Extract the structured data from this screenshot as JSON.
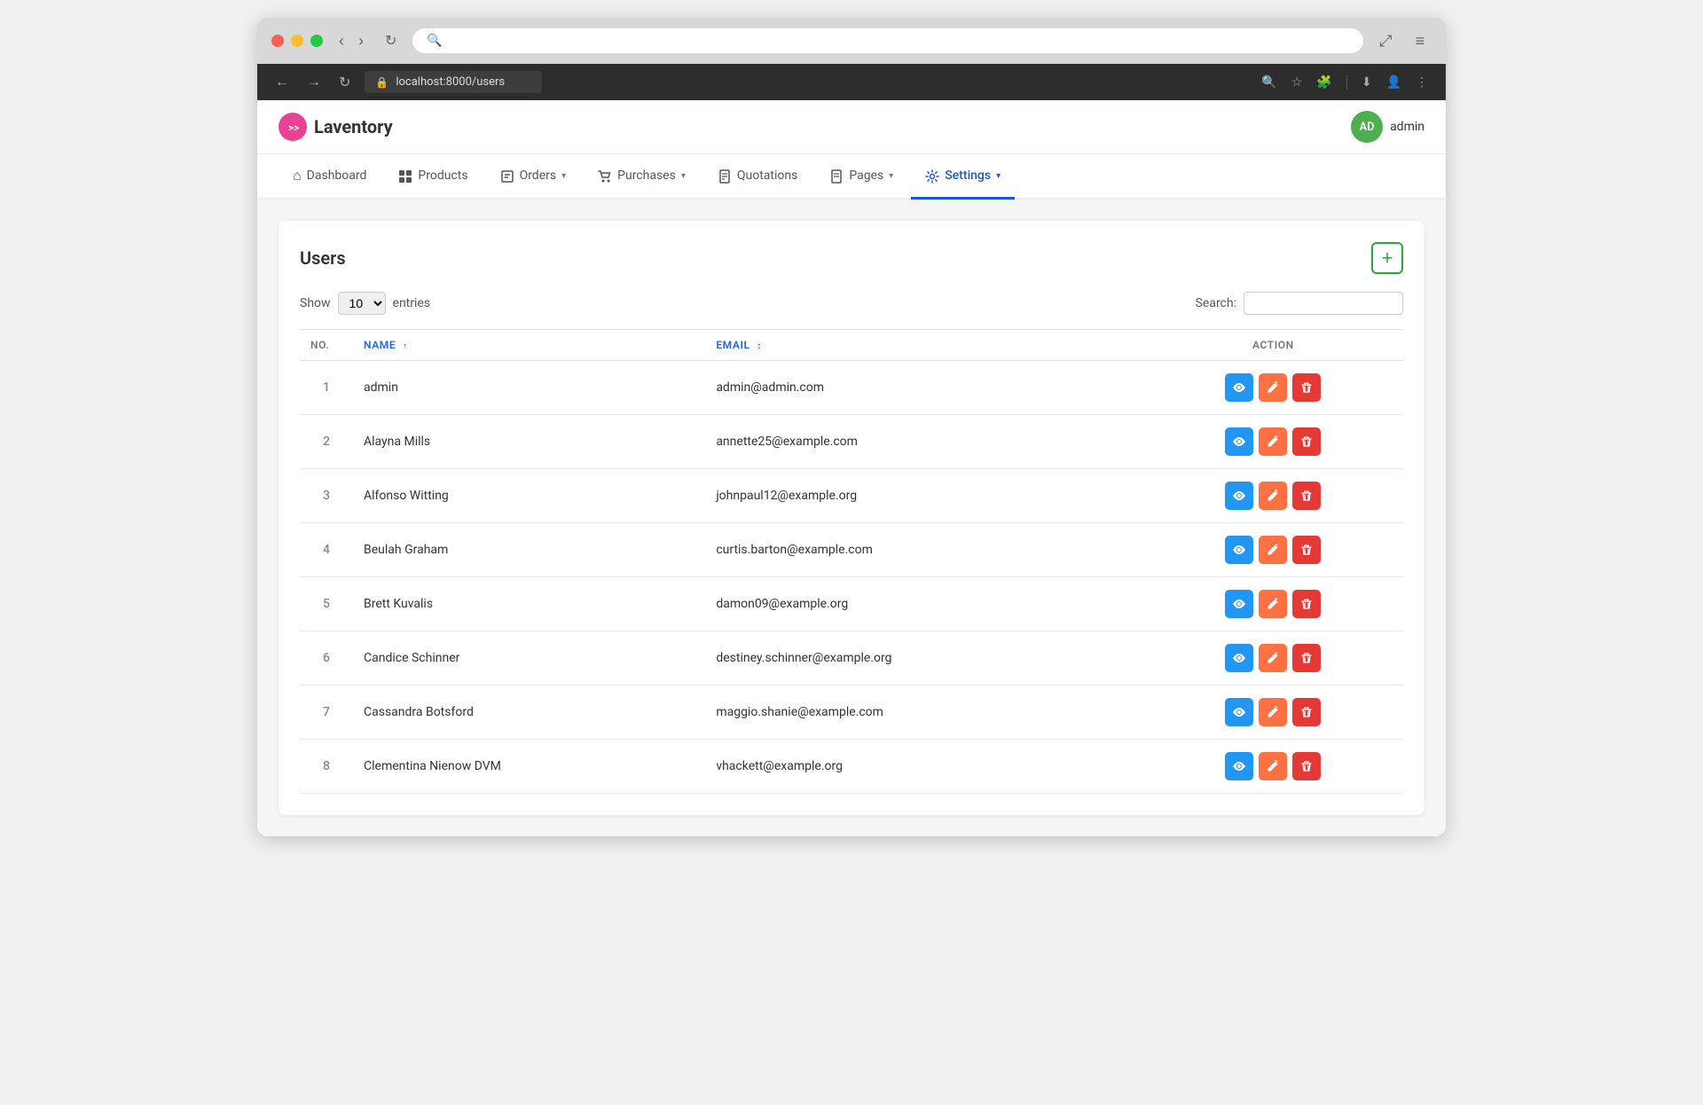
{
  "browser": {
    "url": "localhost:8000/users",
    "title": "Laventory"
  },
  "app": {
    "logo_text": "Laventory",
    "logo_initials": ">>",
    "user_initials": "AD",
    "user_name": "admin",
    "user_bg": "#4CAF50"
  },
  "nav": {
    "items": [
      {
        "id": "dashboard",
        "label": "Dashboard",
        "icon": "⌂",
        "active": false
      },
      {
        "id": "products",
        "label": "Products",
        "icon": "⊞",
        "active": false
      },
      {
        "id": "orders",
        "label": "Orders",
        "icon": "📋",
        "active": false,
        "has_dropdown": true
      },
      {
        "id": "purchases",
        "label": "Purchases",
        "icon": "🛒",
        "active": false,
        "has_dropdown": true
      },
      {
        "id": "quotations",
        "label": "Quotations",
        "icon": "📄",
        "active": false
      },
      {
        "id": "pages",
        "label": "Pages",
        "icon": "📑",
        "active": false,
        "has_dropdown": true
      },
      {
        "id": "settings",
        "label": "Settings",
        "icon": "⚙",
        "active": true,
        "has_dropdown": true
      }
    ]
  },
  "page": {
    "title": "Users",
    "add_label": "+",
    "show_label": "Show",
    "entries_label": "entries",
    "show_value": "10",
    "search_label": "Search:",
    "search_placeholder": ""
  },
  "table": {
    "columns": [
      {
        "id": "no",
        "label": "NO.",
        "sortable": false
      },
      {
        "id": "name",
        "label": "NAME",
        "sortable": true
      },
      {
        "id": "email",
        "label": "EMAIL",
        "sortable": true
      },
      {
        "id": "action",
        "label": "ACTION",
        "sortable": false
      }
    ],
    "rows": [
      {
        "no": 1,
        "name": "admin",
        "email": "admin@admin.com"
      },
      {
        "no": 2,
        "name": "Alayna Mills",
        "email": "annette25@example.com"
      },
      {
        "no": 3,
        "name": "Alfonso Witting",
        "email": "johnpaul12@example.org"
      },
      {
        "no": 4,
        "name": "Beulah Graham",
        "email": "curtis.barton@example.com"
      },
      {
        "no": 5,
        "name": "Brett Kuvalis",
        "email": "damon09@example.org"
      },
      {
        "no": 6,
        "name": "Candice Schinner",
        "email": "destiney.schinner@example.org"
      },
      {
        "no": 7,
        "name": "Cassandra Botsford",
        "email": "maggio.shanie@example.com"
      },
      {
        "no": 8,
        "name": "Clementina Nienow DVM",
        "email": "vhackett@example.org"
      }
    ]
  },
  "actions": {
    "view_label": "👁",
    "edit_label": "✏",
    "delete_label": "🗑"
  }
}
